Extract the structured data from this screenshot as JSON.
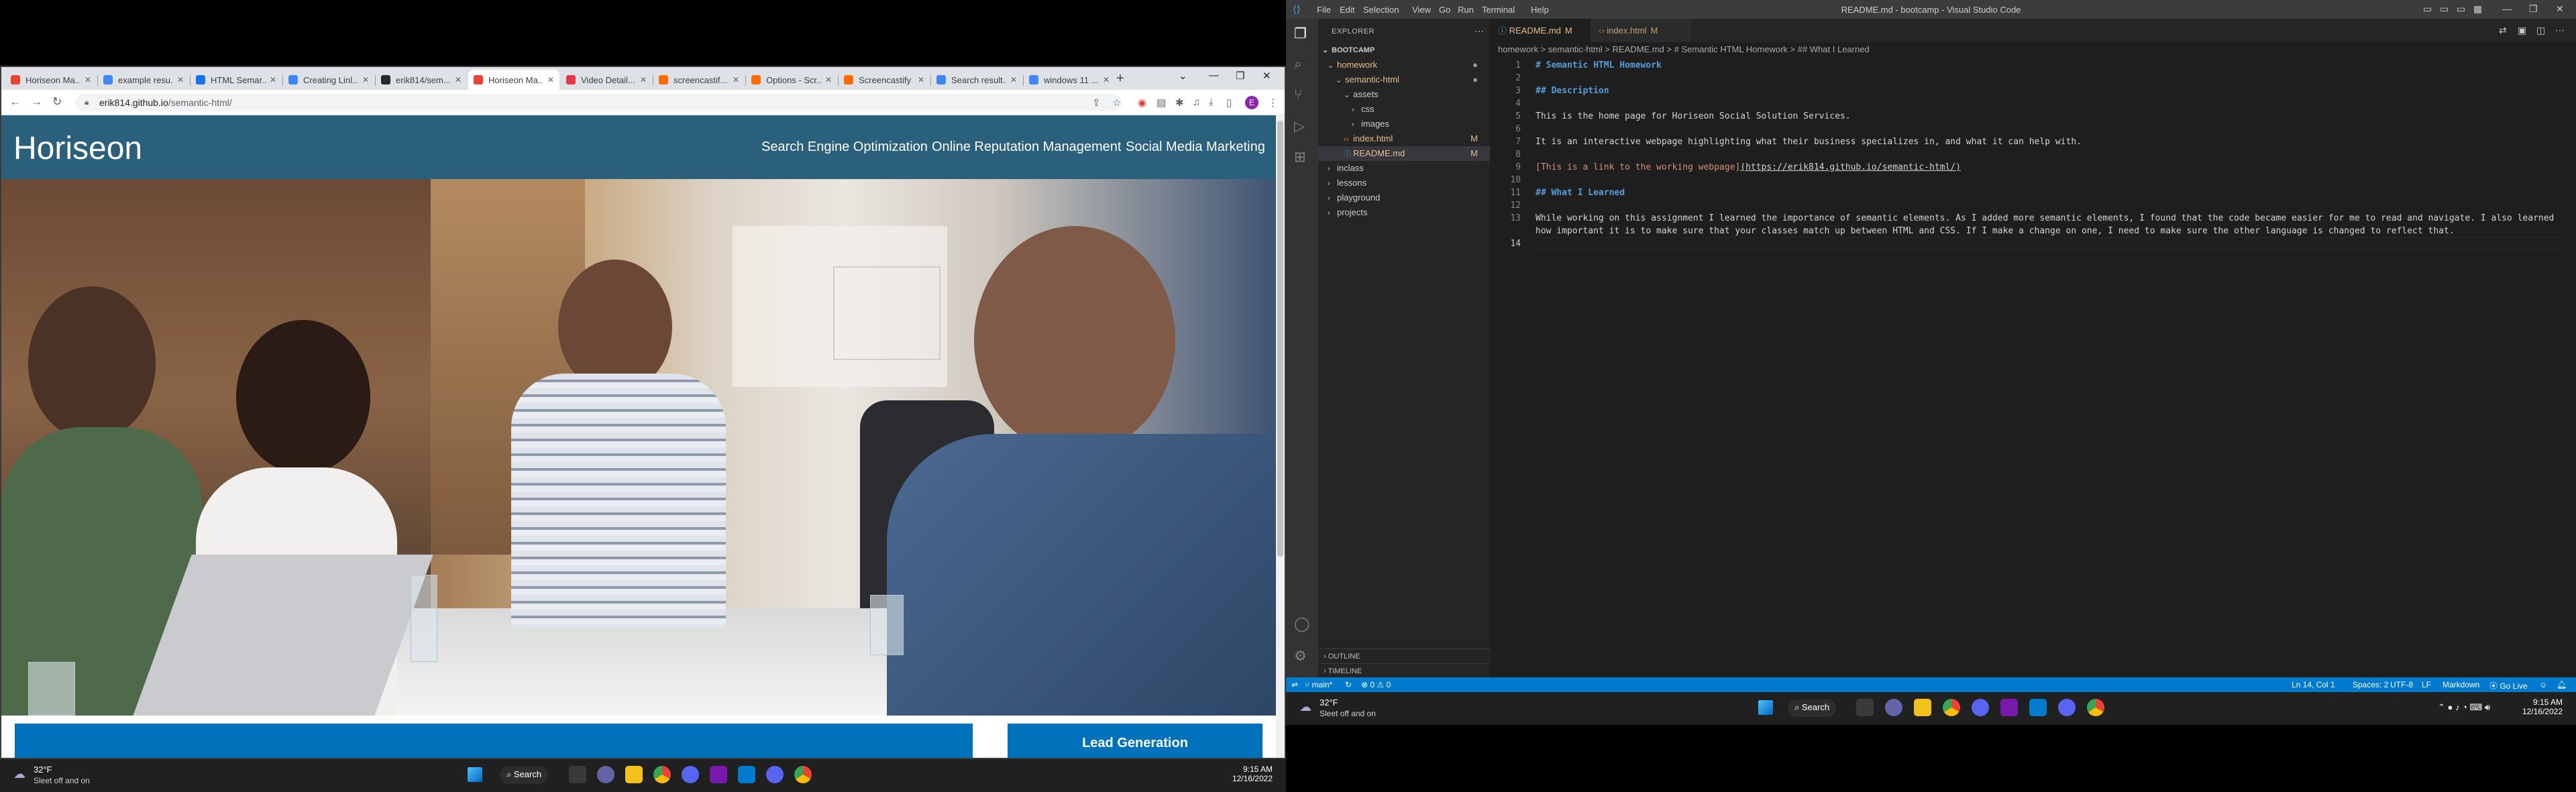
{
  "browser": {
    "tabs": [
      {
        "title": "Horiseon Ma...",
        "favicon_color": "#ea4335"
      },
      {
        "title": "example resu...",
        "favicon_color": "#4285f4"
      },
      {
        "title": "HTML Semar...",
        "favicon_color": "#1a73e8"
      },
      {
        "title": "Creating Linl...",
        "favicon_color": "#4285f4"
      },
      {
        "title": "erik814/sem...",
        "favicon_color": "#24292f"
      },
      {
        "title": "Horiseon Ma...",
        "favicon_color": "#ea4335"
      },
      {
        "title": "Video Detail...",
        "favicon_color": "#e63946"
      },
      {
        "title": "screencastif...",
        "favicon_color": "#ff6d00"
      },
      {
        "title": "Options - Scr...",
        "favicon_color": "#ff6d00"
      },
      {
        "title": "Screencastify",
        "favicon_color": "#ff6d00"
      },
      {
        "title": "Search result...",
        "favicon_color": "#4285f4"
      },
      {
        "title": "windows 11 ...",
        "favicon_color": "#4285f4"
      }
    ],
    "url_host": "erik814.github.io",
    "url_path": "/semantic-html/",
    "profile_initial": "E"
  },
  "site": {
    "logo": "Horiseon",
    "nav": [
      "Search Engine Optimization",
      "Online Reputation Management",
      "Social Media Marketing"
    ],
    "lead_title": "Lead Generation",
    "colors": {
      "header": "#2a607c",
      "panel": "#0072bb"
    }
  },
  "taskbar_left": {
    "temp": "32°F",
    "weather": "Sleet off and on",
    "search": "Search",
    "time": "9:15 AM",
    "date": "12/16/2022"
  },
  "vscode": {
    "menu": [
      "File",
      "Edit",
      "Selection",
      "View",
      "Go",
      "Run",
      "Terminal",
      "Help"
    ],
    "title": "README.md - bootcamp - Visual Studio Code",
    "explorer_header": "EXPLORER",
    "workspace": "BOOTCAMP",
    "tree": [
      {
        "label": "homework",
        "depth": 0,
        "open": true,
        "mod": true
      },
      {
        "label": "semantic-html",
        "depth": 1,
        "open": true,
        "mod": true
      },
      {
        "label": "assets",
        "depth": 2,
        "open": true,
        "mod": false
      },
      {
        "label": "css",
        "depth": 3,
        "open": false,
        "mod": false
      },
      {
        "label": "images",
        "depth": 3,
        "open": false,
        "mod": false
      },
      {
        "label": "index.html",
        "depth": 2,
        "file": true,
        "mod": true,
        "badge": "M"
      },
      {
        "label": "README.md",
        "depth": 2,
        "file": true,
        "mod": true,
        "badge": "M",
        "selected": true
      },
      {
        "label": "inclass",
        "depth": 0,
        "open": false,
        "mod": false
      },
      {
        "label": "lessons",
        "depth": 0,
        "open": false,
        "mod": false
      },
      {
        "label": "playground",
        "depth": 0,
        "open": false,
        "mod": false
      },
      {
        "label": "projects",
        "depth": 0,
        "open": false,
        "mod": false
      }
    ],
    "outline": "OUTLINE",
    "timeline": "TIMELINE",
    "tabs": [
      {
        "label": "README.md",
        "flag": "M"
      },
      {
        "label": "index.html",
        "flag": "M"
      }
    ],
    "breadcrumbs": "homework  >  semantic-html  >  README.md  >  # Semantic HTML Homework  >  ## What I Learned",
    "code": [
      {
        "n": "1",
        "t": "# Semantic HTML Homework",
        "k": "hd"
      },
      {
        "n": "2",
        "t": "",
        "k": ""
      },
      {
        "n": "3",
        "t": "## Description",
        "k": "hd"
      },
      {
        "n": "4",
        "t": "",
        "k": ""
      },
      {
        "n": "5",
        "t": "This is the home page for Horiseon Social Solution Services.",
        "k": ""
      },
      {
        "n": "6",
        "t": "",
        "k": ""
      },
      {
        "n": "7",
        "t": "It is an interactive webpage highlighting what their business specializes in, and what it can help with.",
        "k": ""
      },
      {
        "n": "8",
        "t": "",
        "k": ""
      },
      {
        "n": "9",
        "t": "[This is a link to the working webpage]",
        "k": "lk",
        "u": "(https://erik814.github.io/semantic-html/)"
      },
      {
        "n": "10",
        "t": "",
        "k": ""
      },
      {
        "n": "11",
        "t": "## What I Learned",
        "k": "hd"
      },
      {
        "n": "12",
        "t": "",
        "k": ""
      },
      {
        "n": "13",
        "t": "While working on this assignment I learned the importance of semantic elements. As I added more semantic elements, I found that the code became easier for me to read and navigate. I also learned",
        "k": ""
      },
      {
        "n": "",
        "t": "how important it is to make sure that your classes match up between HTML and CSS. If I make a change on one, I need to make sure the other language is changed to reflect that.",
        "k": ""
      },
      {
        "n": "14",
        "t": "",
        "k": "",
        "cur": true
      }
    ],
    "status": {
      "branch": "main*",
      "problems": "0 ⚠ 0",
      "position": "Ln 14, Col 1",
      "spaces": "Spaces: 2",
      "encoding": "UTF-8",
      "eol": "LF",
      "language": "Markdown",
      "golive": "Go Live"
    }
  },
  "taskbar_right": {
    "temp": "32°F",
    "weather": "Sleet off and on",
    "search": "Search",
    "time": "9:15 AM",
    "date": "12/16/2022"
  }
}
